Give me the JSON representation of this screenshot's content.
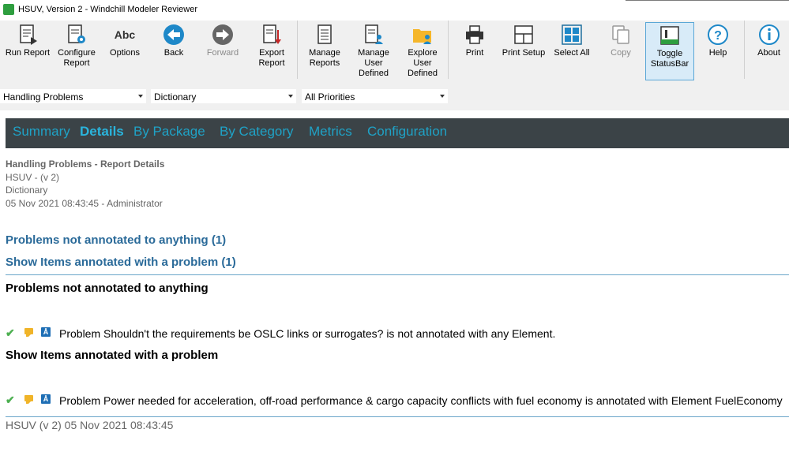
{
  "window": {
    "title": "HSUV, Version 2 - Windchill Modeler Reviewer"
  },
  "toolbar": {
    "run_report": "Run Report",
    "configure_report": "Configure Report",
    "options": "Options",
    "back": "Back",
    "forward": "Forward",
    "export_report": "Export Report",
    "manage_reports": "Manage Reports",
    "manage_user_defined": "Manage User Defined",
    "explore_user_defined": "Explore User Defined",
    "print": "Print",
    "print_setup": "Print Setup",
    "select_all": "Select All",
    "copy": "Copy",
    "toggle_statusbar": "Toggle StatusBar",
    "help": "Help",
    "about": "About",
    "abc_glyph": "Abc"
  },
  "filters": {
    "report": "Handling Problems",
    "dictionary": "Dictionary",
    "priority": "All Priorities"
  },
  "nav": {
    "tabs": [
      "Summary",
      "Details",
      "By Package",
      "By Category",
      "Metrics",
      "Configuration"
    ],
    "active": "Details"
  },
  "meta": {
    "heading": "Handling Problems - Report Details",
    "model": "HSUV - (v 2)",
    "dictionary": "Dictionary",
    "timestamp": "05 Nov 2021 08:43:45 - Administrator"
  },
  "links": {
    "not_annotated": "Problems not annotated to anything (1)",
    "annotated": "Show Items annotated with a problem (1)"
  },
  "sections": {
    "not_annotated": "Problems not annotated to anything",
    "annotated": "Show Items annotated with a problem"
  },
  "problems": {
    "not_annotated_row": "Problem Shouldn't the requirements be OSLC links or surrogates? is not annotated with any Element.",
    "annotated_row": "Problem Power needed for acceleration, off-road performance & cargo capacity conflicts with fuel economy is annotated with Element FuelEconomy"
  },
  "footer": {
    "text": "HSUV (v 2) 05 Nov 2021 08:43:45"
  },
  "colors": {
    "nav_bg": "#3b4347",
    "nav_link": "#1fa2c6",
    "link": "#2a6a99",
    "check": "#4caf50",
    "comment": "#f0b429",
    "problem_icon": "#1f6fb5"
  }
}
